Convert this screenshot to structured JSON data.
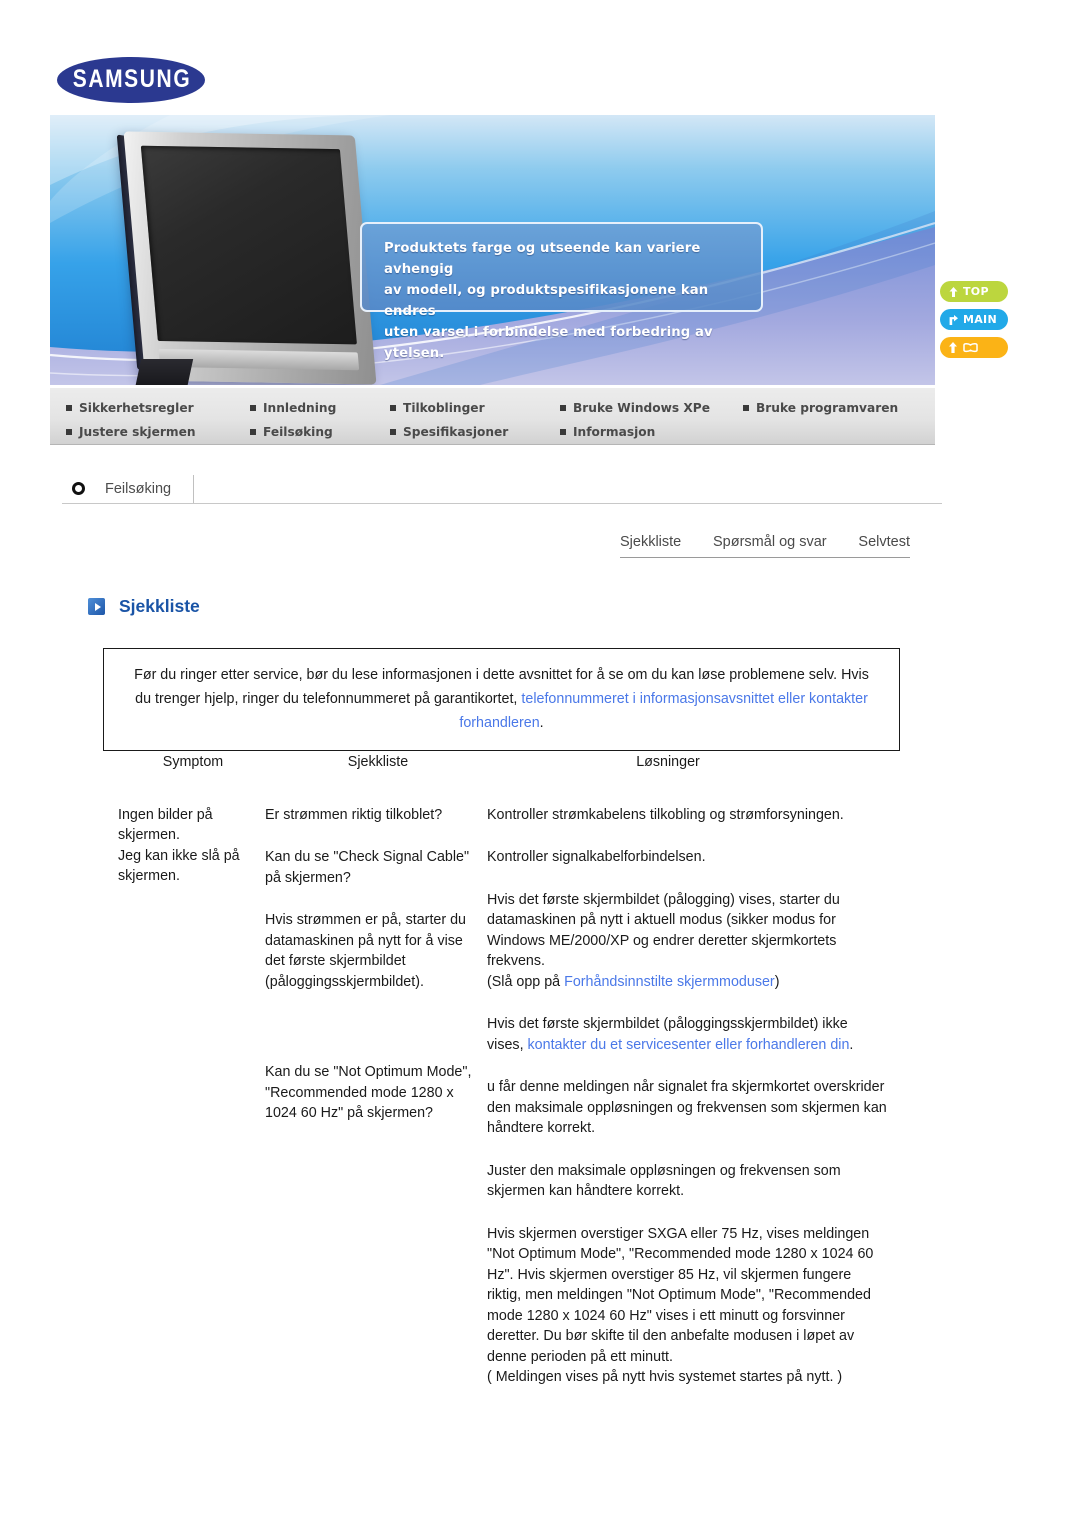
{
  "brand": {
    "logo_text": "SAMSUNG"
  },
  "banner": {
    "notice_lines": [
      "Produktets farge og utseende kan variere avhengig",
      "av modell, og produktspesifikasjonene kan endres",
      "uten varsel i forbindelse med forbedring av ytelsen."
    ]
  },
  "side_buttons": [
    {
      "label": "TOP",
      "color": "#bcd63e",
      "icon": "up-arrow-icon"
    },
    {
      "label": "MAIN",
      "color": "#21a9e8",
      "icon": "branch-arrow-icon"
    },
    {
      "label": "",
      "color": "#fbb316",
      "icon": "up-arrow-book-icon"
    }
  ],
  "nav": {
    "row1": [
      "Sikkerhetsregler",
      "Innledning",
      "Tilkoblinger",
      "Bruke Windows XPe",
      "Bruke programvaren"
    ],
    "row2": [
      "Justere skjermen",
      "Feilsøking",
      "Spesifikasjoner",
      "Informasjon"
    ]
  },
  "section": {
    "title": "Feilsøking"
  },
  "tabs": [
    {
      "label": "Sjekkliste"
    },
    {
      "label": "Spørsmål og svar"
    },
    {
      "label": "Selvtest"
    }
  ],
  "page": {
    "heading": "Sjekkliste"
  },
  "infobox": {
    "text_before_link": "Før du ringer etter service, bør du lese informasjonen i dette avsnittet for å se om du kan løse problemene selv. Hvis du trenger hjelp, ringer du telefonnummeret på garantikortet, ",
    "link_text": "telefonnummeret i informasjonsavsnittet eller kontakter forhandleren",
    "text_after_link": "."
  },
  "table": {
    "headers": [
      "Symptom",
      "Sjekkliste",
      "Løsninger"
    ],
    "symptom": "Ingen bilder på skjermen.\nJeg kan ikke slå på skjermen.",
    "rows": [
      {
        "checklist": "Er strømmen riktig tilkoblet?",
        "solution": "Kontroller strømkabelens tilkobling og strømforsyningen."
      },
      {
        "checklist": "Kan du se \"Check Signal Cable\" på skjermen?",
        "solution": "Kontroller signalkabelforbindelsen."
      },
      {
        "checklist": "Hvis strømmen er på, starter du datamaskinen på nytt for å vise det første skjermbildet (påloggingsskjermbildet).",
        "solution_p1": "Hvis det første skjermbildet (pålogging) vises, starter du datamaskinen på nytt i aktuell modus (sikker modus for Windows ME/2000/XP og endrer deretter skjermkortets frekvens.",
        "solution_p2_prefix": "(Slå opp på ",
        "solution_p2_link": "Forhåndsinnstilte skjermmoduser",
        "solution_p2_suffix": ")",
        "solution_p3_prefix": "Hvis det første skjermbildet (påloggingsskjermbildet) ikke vises, ",
        "solution_p3_link": "kontakter du et servicesenter eller forhandleren din",
        "solution_p3_suffix": "."
      },
      {
        "checklist": "Kan du se \"Not Optimum Mode\", \"Recommended mode 1280 x 1024 60 Hz\" på skjermen?",
        "solution_p1": "u får denne meldingen når signalet fra skjermkortet overskrider den maksimale oppløsningen og frekvensen som skjermen kan håndtere korrekt.",
        "solution_p2": "Juster den maksimale oppløsningen og frekvensen som skjermen kan håndtere korrekt.",
        "solution_p3": "Hvis skjermen overstiger SXGA eller 75 Hz, vises meldingen \"Not Optimum Mode\", \"Recommended mode 1280 x 1024 60 Hz\". Hvis skjermen overstiger 85 Hz, vil skjermen fungere riktig, men meldingen \"Not Optimum Mode\", \"Recommended mode 1280 x 1024 60 Hz\" vises i ett minutt og forsvinner deretter. Du bør skifte til den anbefalte modusen i løpet av denne perioden på ett minutt.",
        "solution_p4": "( Meldingen vises på nytt hvis systemet startes på nytt. )"
      }
    ]
  }
}
